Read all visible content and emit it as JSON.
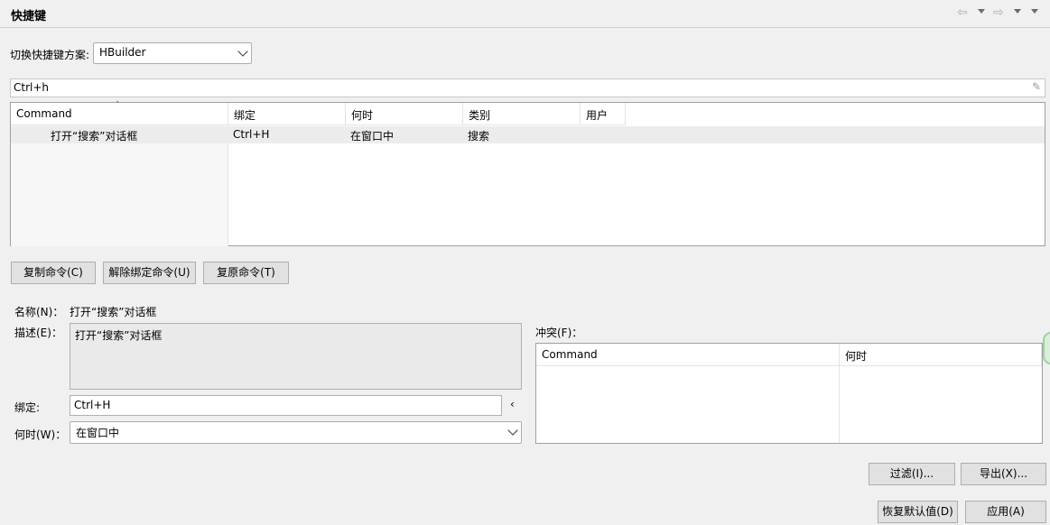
{
  "header": {
    "title": "快捷键"
  },
  "scheme": {
    "label": "切换快捷键方案:",
    "value": "HBuilder"
  },
  "filter": {
    "value": "Ctrl+h"
  },
  "table": {
    "columns": [
      "Command",
      "绑定",
      "何时",
      "类别",
      "用户"
    ],
    "rows": [
      {
        "command": "打开“搜索”对话框",
        "binding": "Ctrl+H",
        "when": "在窗口中",
        "category": "搜索",
        "user": ""
      }
    ]
  },
  "buttons": {
    "copy": "复制命令(C)",
    "unbind": "解除绑定命令(U)",
    "restore": "复原命令(T)",
    "filter": "过滤(I)...",
    "export": "导出(X)...",
    "restore_defaults": "恢复默认值(D)",
    "apply": "应用(A)"
  },
  "details": {
    "name_label": "名称(N)：",
    "name_value": "打开“搜索”对话框",
    "desc_label": "描述(E)：",
    "desc_value": "打开“搜索”对话框",
    "binding_label": "绑定:",
    "binding_value": "Ctrl+H",
    "when_label": "何时(W)：",
    "when_value": "在窗口中"
  },
  "conflicts": {
    "label": "冲突(F)：",
    "columns": [
      "Command",
      "何时"
    ]
  }
}
